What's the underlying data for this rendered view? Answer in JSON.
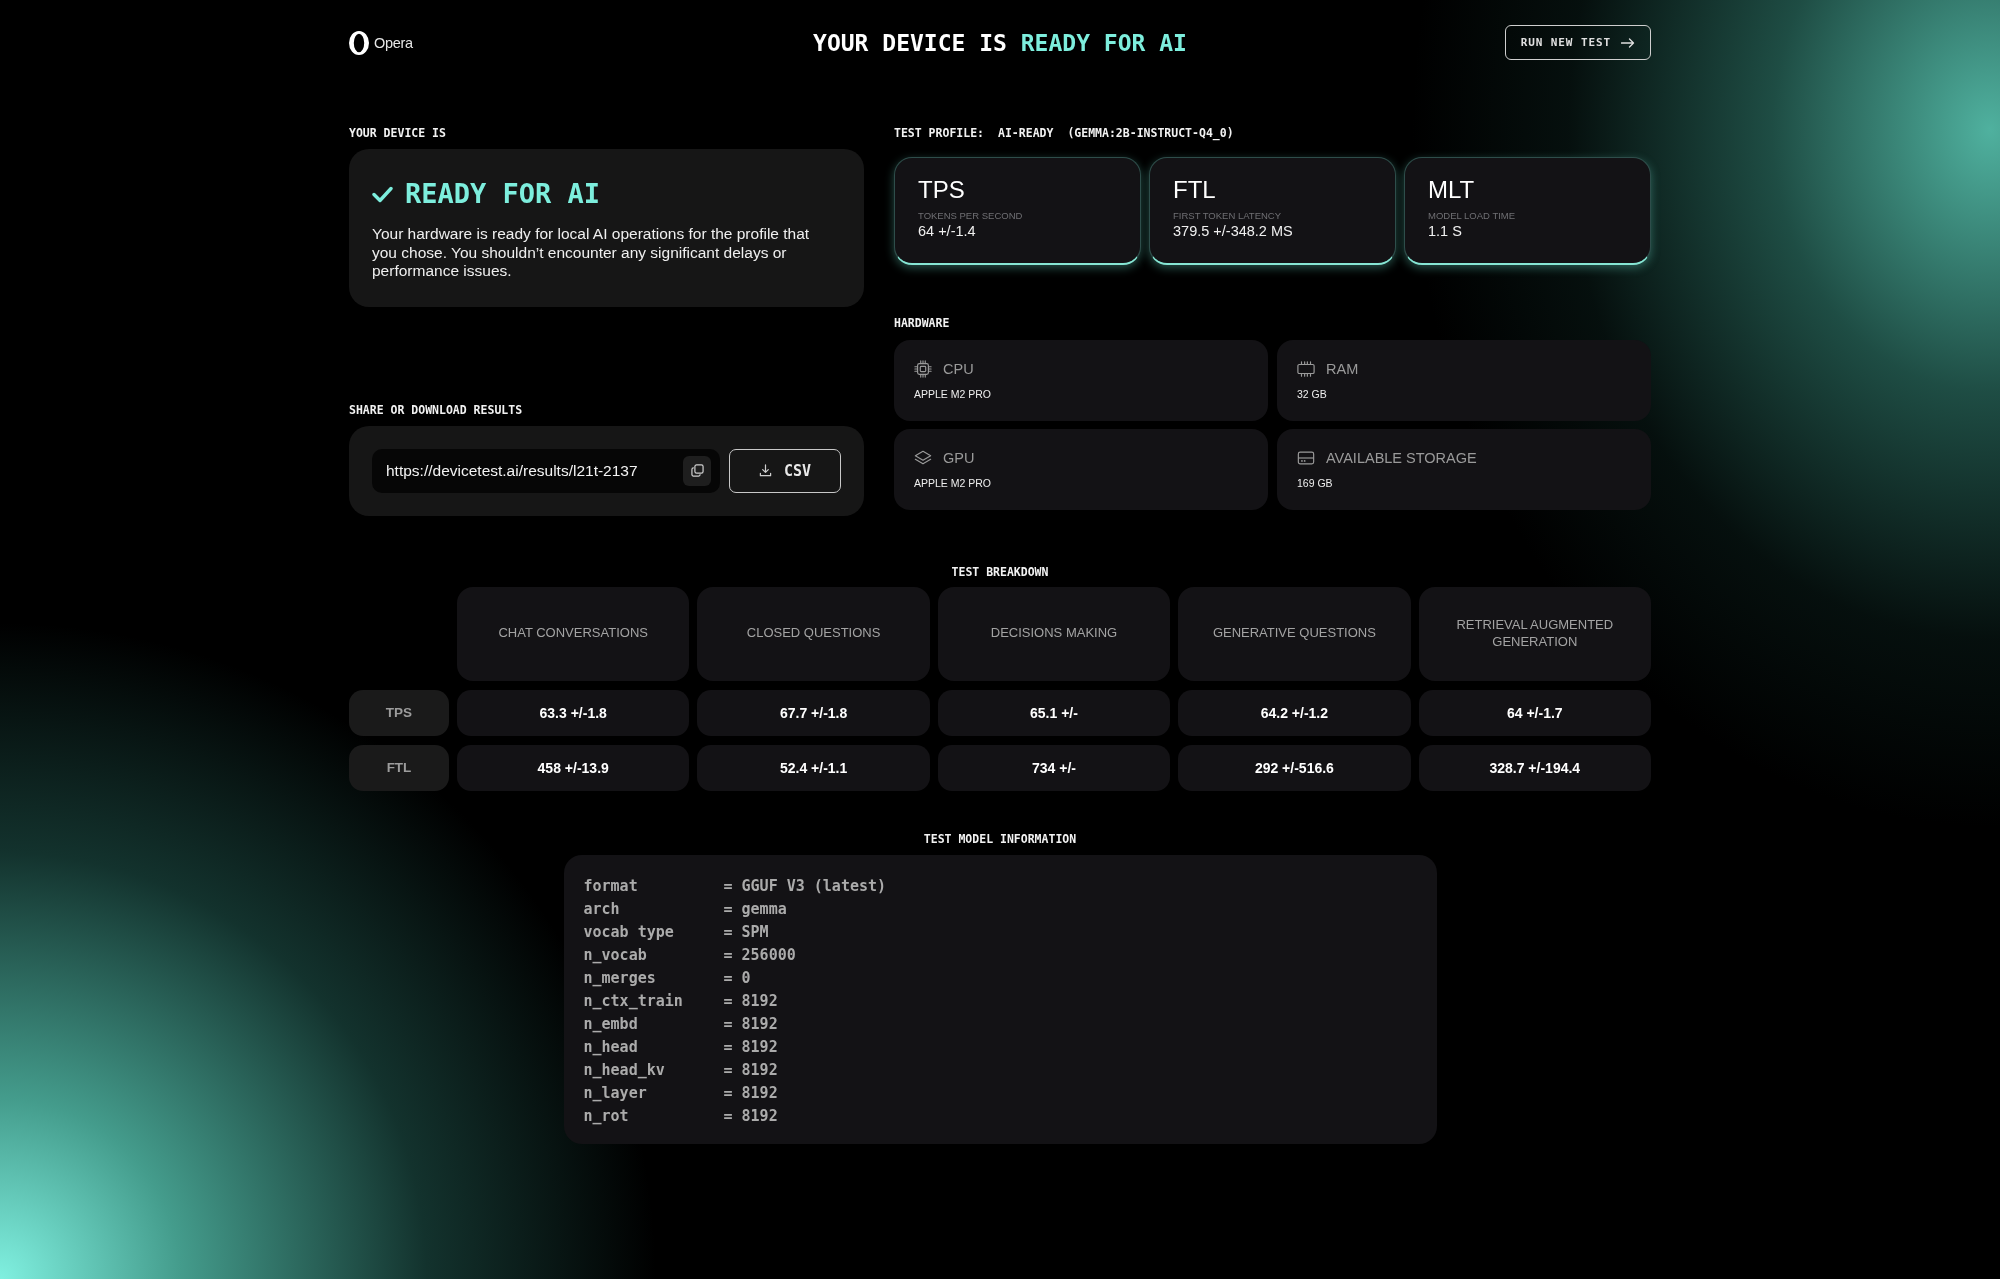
{
  "header": {
    "logo": "Opera",
    "title": "YOUR DEVICE IS",
    "title_highlight": "READY FOR AI",
    "action": "RUN NEW TEST"
  },
  "status": {
    "label": "YOUR DEVICE IS",
    "heading": "READY FOR AI",
    "description": "Your hardware is ready for local AI operations for the profile that you chose. You shouldn’t encounter any significant delays or performance issues."
  },
  "share": {
    "label": "SHARE OR DOWNLOAD RESULTS",
    "url": "https://devicetest.ai/results/l21t-2137",
    "download": "CSV"
  },
  "profile": {
    "label": "TEST PROFILE:",
    "name": "AI-READY",
    "model": "(GEMMA:2B-INSTRUCT-Q4_0)"
  },
  "metrics": [
    {
      "abbr": "TPS",
      "name": "TOKENS PER SECOND",
      "value": "64 +/-1.4"
    },
    {
      "abbr": "FTL",
      "name": "FIRST TOKEN LATENCY",
      "value": "379.5 +/-348.2 MS"
    },
    {
      "abbr": "MLT",
      "name": "MODEL LOAD TIME",
      "value": "1.1 S"
    }
  ],
  "hardware": {
    "label": "HARDWARE",
    "items": [
      {
        "kind": "cpu",
        "name": "CPU",
        "value": "APPLE M2 PRO"
      },
      {
        "kind": "ram",
        "name": "RAM",
        "value": "32 GB"
      },
      {
        "kind": "gpu",
        "name": "GPU",
        "value": "APPLE M2 PRO"
      },
      {
        "kind": "storage",
        "name": "AVAILABLE STORAGE",
        "value": "169 GB"
      }
    ]
  },
  "breakdown": {
    "title": "TEST BREAKDOWN",
    "columns": [
      "CHAT CONVERSATIONS",
      "CLOSED QUESTIONS",
      "DECISIONS MAKING",
      "GENERATIVE QUESTIONS",
      "RETRIEVAL AUGMENTED GENERATION"
    ],
    "rows": [
      {
        "label": "TPS",
        "cells": [
          "63.3 +/-1.8",
          "67.7 +/-1.8",
          "65.1 +/-",
          "64.2 +/-1.2",
          "64 +/-1.7"
        ]
      },
      {
        "label": "FTL",
        "cells": [
          "458 +/-13.9",
          "52.4 +/-1.1",
          "734 +/-",
          "292 +/-516.6",
          "328.7 +/-194.4"
        ]
      }
    ]
  },
  "model_info": {
    "title": "TEST MODEL INFORMATION",
    "rows": [
      {
        "key": "format",
        "value": "= GGUF V3 (latest)"
      },
      {
        "key": "arch",
        "value": "= gemma"
      },
      {
        "key": "vocab type",
        "value": "= SPM"
      },
      {
        "key": "n_vocab",
        "value": "= 256000"
      },
      {
        "key": "n_merges",
        "value": "= 0"
      },
      {
        "key": "n_ctx_train",
        "value": "= 8192"
      },
      {
        "key": "n_embd",
        "value": "= 8192"
      },
      {
        "key": "n_head",
        "value": "= 8192"
      },
      {
        "key": "n_head_kv",
        "value": "= 8192"
      },
      {
        "key": "n_layer",
        "value": "= 8192"
      },
      {
        "key": "n_rot",
        "value": "= 8192"
      }
    ]
  }
}
